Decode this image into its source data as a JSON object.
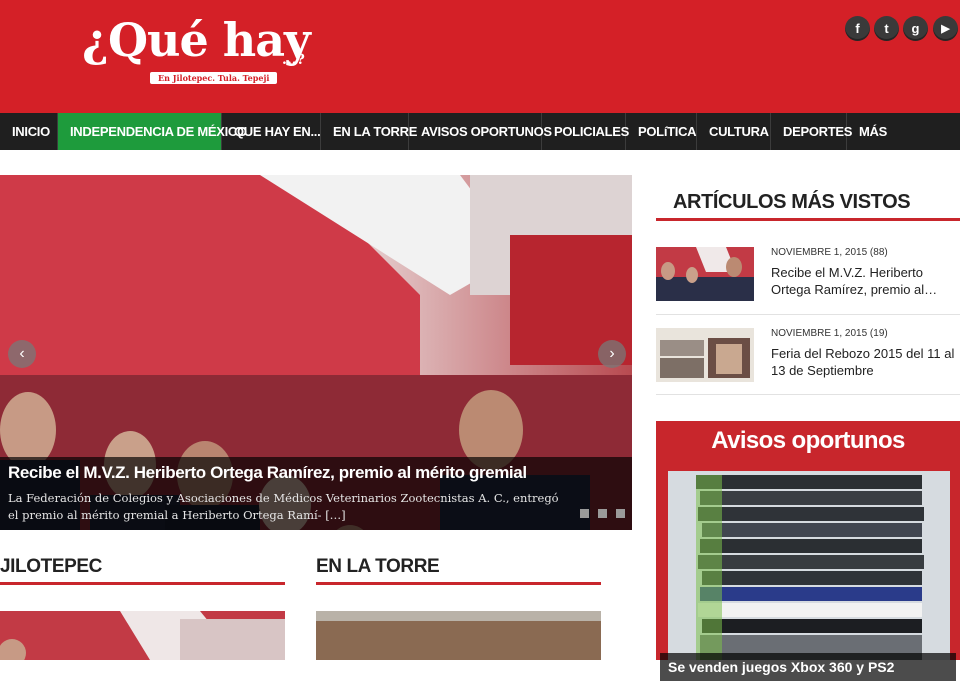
{
  "brand": {
    "logo_text": "¿Qué hay",
    "logo_dots": "...?",
    "tagline": "En Jilotepec. Tula. Tepeji"
  },
  "social": [
    {
      "name": "facebook-icon",
      "glyph": "f"
    },
    {
      "name": "twitter-icon",
      "glyph": "t"
    },
    {
      "name": "google-plus-icon",
      "glyph": "g"
    },
    {
      "name": "youtube-icon",
      "glyph": "▶"
    }
  ],
  "nav": {
    "items": [
      {
        "label": "INICIO"
      },
      {
        "label": "INDEPENDENCIA DE MÉXICO"
      },
      {
        "label": "QUE HAY EN..."
      },
      {
        "label": "EN LA TORRE"
      },
      {
        "label": "AVISOS OPORTUNOS"
      },
      {
        "label": "POLICIALES"
      },
      {
        "label": "POLíTICA"
      },
      {
        "label": "CULTURA"
      },
      {
        "label": "DEPORTES"
      },
      {
        "label": "MÁS"
      }
    ]
  },
  "slider": {
    "title": "Recibe el M.V.Z. Heriberto Ortega Ramírez, premio al mérito gremial",
    "excerpt": "La Federación de Colegios y Asociaciones de Médicos Veterinarios Zootecnistas A. C., entregó el premio al mérito gremial a Heriberto Ortega Ramí- […]",
    "prev": "‹",
    "next": "›",
    "slide_count": 3
  },
  "sections": {
    "jilotepec": "JILOTEPEC",
    "en_la_torre": "EN LA TORRE"
  },
  "sidebar": {
    "most_viewed_title": "ARTÍCULOS MÁS VISTOS",
    "items": [
      {
        "date": "NOVIEMBRE 1, 2015 (88)",
        "title": "Recibe el M.V.Z. Heriberto Ortega Ramírez, premio al…"
      },
      {
        "date": "NOVIEMBRE 1, 2015 (19)",
        "title": "Feria del Rebozo 2015 del 11 al 13 de Septiembre"
      }
    ],
    "avisos_title": "Avisos oportunos",
    "avisos_caption": "Se venden juegos Xbox 360 y PS2"
  },
  "colors": {
    "brand_red": "#d42027",
    "nav_bg": "#1f1f1f",
    "nav_active": "#1e9b3c",
    "section_rule": "#c8262c"
  }
}
